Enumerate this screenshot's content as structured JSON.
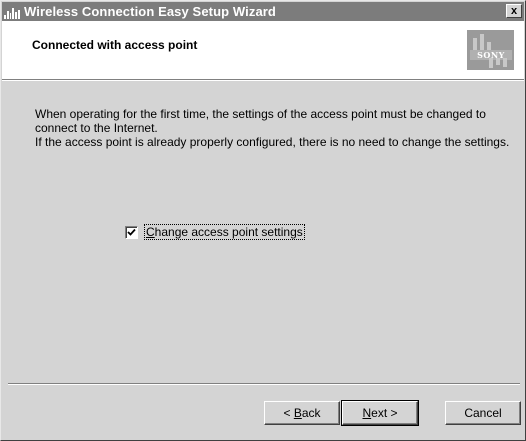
{
  "window": {
    "title": "Wireless Connection Easy Setup Wizard",
    "close_label": "x"
  },
  "header": {
    "title": "Connected with access point",
    "logo_text": "SONY"
  },
  "body": {
    "line1": "When operating for the first time, the settings of the access point must be changed to",
    "line2": "connect to the Internet.",
    "line3": "If the access point is already properly configured, there is no need to change the settings."
  },
  "checkbox": {
    "label_mnemonic": "C",
    "label_rest": "hange access point settings",
    "checked": true
  },
  "buttons": {
    "back_prefix": "< ",
    "back_mnemonic": "B",
    "back_rest": "ack",
    "next_mnemonic": "N",
    "next_rest": "ext >",
    "cancel": "Cancel"
  }
}
